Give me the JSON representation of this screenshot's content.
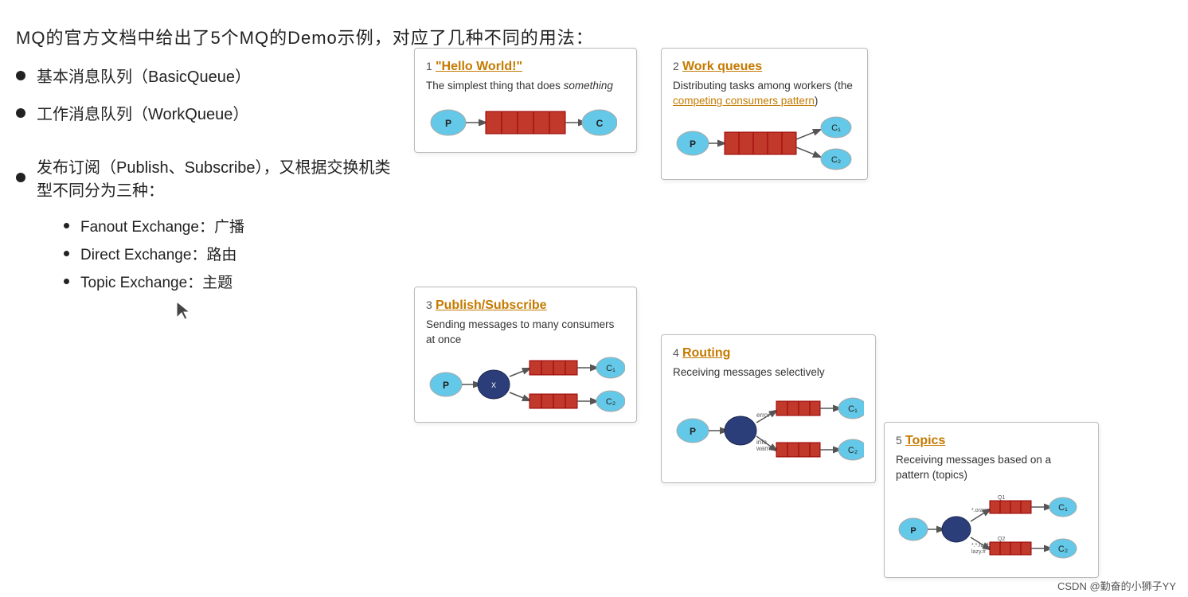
{
  "title": "MQ的官方文档中给出了5个MQ的Demo示例，对应了几种不同的用法：",
  "bullets": [
    {
      "id": "b1",
      "text": "基本消息队列（BasicQueue）"
    },
    {
      "id": "b2",
      "text": "工作消息队列（WorkQueue）"
    },
    {
      "id": "b3",
      "text": "发布订阅（Publish、Subscribe），又根据交换机类型不同分为三种："
    }
  ],
  "subbullets": [
    {
      "id": "sb1",
      "text": "Fanout Exchange：广播"
    },
    {
      "id": "sb2",
      "text": "Direct Exchange：路由"
    },
    {
      "id": "sb3",
      "text": "Topic Exchange：主题"
    }
  ],
  "cards": {
    "card1": {
      "num": "1",
      "title": "\"Hello World!\"",
      "desc": "The simplest thing that does something",
      "desc_italic": "something"
    },
    "card2": {
      "num": "2",
      "title": "Work queues",
      "desc1": "Distributing tasks among workers (the ",
      "link": "competing consumers pattern",
      "desc2": ")"
    },
    "card3": {
      "num": "3",
      "title": "Publish/Subscribe",
      "desc": "Sending messages to many consumers at once"
    },
    "card4": {
      "num": "4",
      "title": "Routing",
      "desc": "Receiving messages selectively"
    },
    "card5": {
      "num": "5",
      "title": "Topics",
      "desc": "Receiving messages based on a pattern (topics)"
    }
  },
  "watermark": "CSDN @勤奋的小狮子YY"
}
